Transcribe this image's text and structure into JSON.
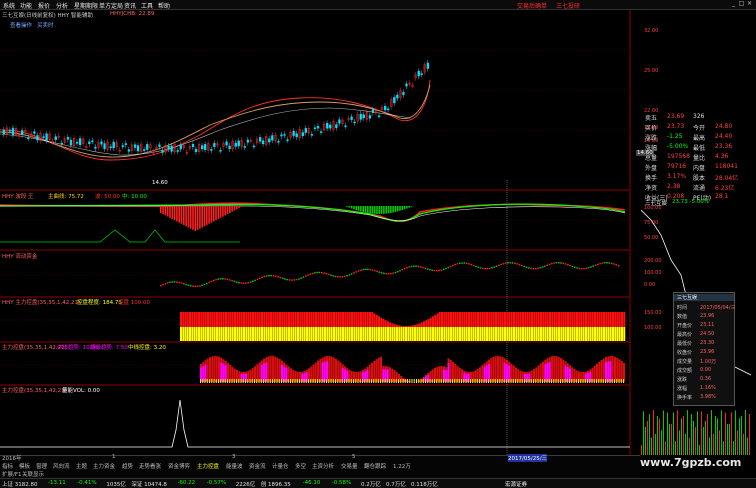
{
  "menu": {
    "items": [
      "系统",
      "功能",
      "报价",
      "分析",
      "星期期限",
      "单方定局",
      "资讯",
      "工具",
      "帮助"
    ],
    "right_links": [
      "交易后确单",
      "三七投研"
    ]
  },
  "header": {
    "stock_line": "三七互娱(日线前复权) HHY 智能辅助",
    "indicator_line": "HHYJCHB: 22.89",
    "sub_links": [
      "查看操作",
      "买卖时"
    ]
  },
  "panels": {
    "hhy": {
      "name": "HHY 波段 王",
      "main_label": "主曲线: 75.72",
      "mid": "波: 50.00",
      "low": "中: 10.00"
    },
    "fund": {
      "name": "HHY 流动资金"
    },
    "main_force": {
      "name": "HHY 主力控盘(35,35,1,42,21)",
      "value": "控盘程度: 184.75",
      "extra": "控盘 100.00"
    },
    "power": {
      "name": "主力控盘(35,35,1,42,21)",
      "a": "中线趋势: 10.00",
      "b": "超级趋势: 7.50",
      "c": "中线控盘: 3.20"
    },
    "volume": {
      "name": "主力控盘(35,35,1,42,21)",
      "a": "量能VOL: 0.00"
    }
  },
  "price_labels": {
    "high_low": "14.60",
    "marker": "14.60"
  },
  "scales": {
    "price": [
      "32.00",
      "25.00",
      "22.00",
      "19.00",
      "16.00"
    ],
    "osc": [
      "100.00",
      "75.00",
      "50.00",
      "25.00",
      "0.00"
    ],
    "fund": [
      "200.00",
      "100.00",
      "0.00",
      "-100.00"
    ],
    "mf": [
      "150.00",
      "100.00",
      "50.00",
      "0.00"
    ]
  },
  "quote": {
    "rows": [
      [
        "卖五",
        "23.69",
        "326"
      ],
      [
        "买价",
        "23.73",
        "今开",
        "24.80"
      ],
      [
        "涨跌",
        "-1.25",
        "最高",
        "24.40"
      ],
      [
        "涨幅",
        "-5.00%",
        "最低",
        "23.36"
      ],
      [
        "总量",
        "197568",
        "量比",
        "4.36"
      ],
      [
        "外盘",
        "79716",
        "内盘",
        "118041"
      ],
      [
        "换手",
        "3.17%",
        "股本",
        "28.04亿"
      ],
      [
        "净资",
        "2.38",
        "流通",
        "6.23亿"
      ],
      [
        "收益(三)",
        "0.208",
        "PE(动)",
        "28.1"
      ]
    ],
    "title": "三七互娱",
    "ratio": "23.73 -5.00%"
  },
  "popup": {
    "title": "三七互娱",
    "rows": [
      [
        "时间",
        "2017/05/04/三"
      ],
      [
        "数值",
        "23.96"
      ],
      [
        "开盘价",
        "23.11"
      ],
      [
        "最高价",
        "24.50"
      ],
      [
        "最低价",
        "23.30"
      ],
      [
        "收盘价",
        "23.96"
      ],
      [
        "成交量",
        "1.00万"
      ],
      [
        "成交额",
        "0.00"
      ],
      [
        "涨跌",
        "0.36"
      ],
      [
        "涨幅",
        "1.16%"
      ],
      [
        "换手率",
        "3.98%"
      ]
    ]
  },
  "bottom": {
    "dates": [
      "2016年",
      "1",
      "3",
      "5",
      "2017/05/25/三"
    ],
    "tabs": [
      "指标",
      "模板",
      "窗理",
      "风向流",
      "主题",
      "主力资金",
      "趋势",
      "走势看涨",
      "资金博弈",
      "主力控盘",
      "能量波",
      "资金流",
      "计量仓",
      "多空",
      "主资分析",
      "交易量",
      "翻仓跟踪",
      "1.22万"
    ],
    "sub_tabs": [
      "扩展/F1",
      "关联显示"
    ]
  },
  "status": {
    "items": [
      "上证 3182.80",
      "-13.11",
      "-0.41%",
      "1035亿",
      "深证 10474.8",
      "-60.22",
      "-0.57%",
      "2226亿",
      "创 1896.35",
      "-46.10",
      "-0.58%",
      "0.2万亿",
      "0.7万亿",
      "0.118万亿"
    ],
    "right": "宏源证券"
  },
  "watermark": "www.7gpzb.com",
  "colors": {
    "up": "#ff2020",
    "down": "#00ff00",
    "bg": "#000000",
    "grid": "#8b0000",
    "yellow": "#ffff00",
    "magenta": "#ff00ff"
  }
}
